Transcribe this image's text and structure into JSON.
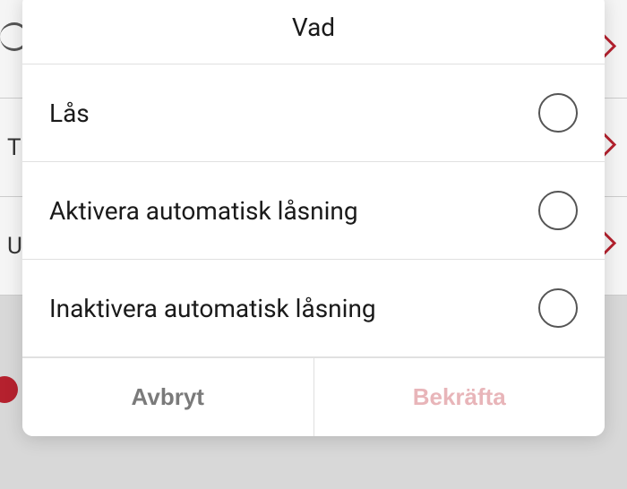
{
  "modal": {
    "title": "Vad",
    "options": [
      {
        "label": "Lås",
        "selected": false
      },
      {
        "label": "Aktivera automatisk låsning",
        "selected": false
      },
      {
        "label": "Inaktivera automatisk låsning",
        "selected": false
      }
    ],
    "cancel_label": "Avbryt",
    "confirm_label": "Bekräfta"
  },
  "background": {
    "hint_t": "T",
    "hint_u": "U"
  },
  "colors": {
    "accent": "#b5212e",
    "confirm_disabled": "#e8b5b9",
    "cancel_text": "#7a7a7a"
  }
}
